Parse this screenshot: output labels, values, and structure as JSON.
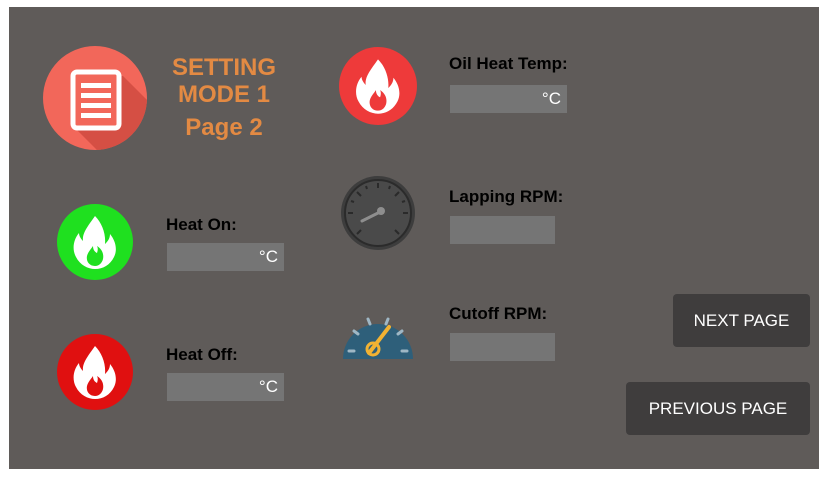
{
  "header": {
    "title_line1": "SETTING",
    "title_line2": "MODE 1",
    "title_line3": "Page 2",
    "icon": "document-icon"
  },
  "heat_on": {
    "label": "Heat On:",
    "value": "",
    "unit": "°C",
    "icon": "flame-icon",
    "icon_color": "#1fe01f"
  },
  "heat_off": {
    "label": "Heat Off:",
    "value": "",
    "unit": "°C",
    "icon": "flame-icon",
    "icon_color": "#e01010"
  },
  "oil_heat_temp": {
    "label": "Oil Heat Temp:",
    "value": "",
    "unit": "°C",
    "icon": "flame-icon",
    "icon_color": "#ee3a3a"
  },
  "lapping_rpm": {
    "label": "Lapping RPM:",
    "value": "",
    "icon": "gauge-icon"
  },
  "cutoff_rpm": {
    "label": "Cutoff RPM:",
    "value": "",
    "icon": "speedometer-icon"
  },
  "buttons": {
    "next_page": "NEXT PAGE",
    "previous_page": "PREVIOUS PAGE"
  },
  "colors": {
    "background": "#5f5b59",
    "title": "#e38a43",
    "document_icon_bg": "#f2675a",
    "field_bg": "#757575",
    "button_bg": "#3f3d3d"
  }
}
